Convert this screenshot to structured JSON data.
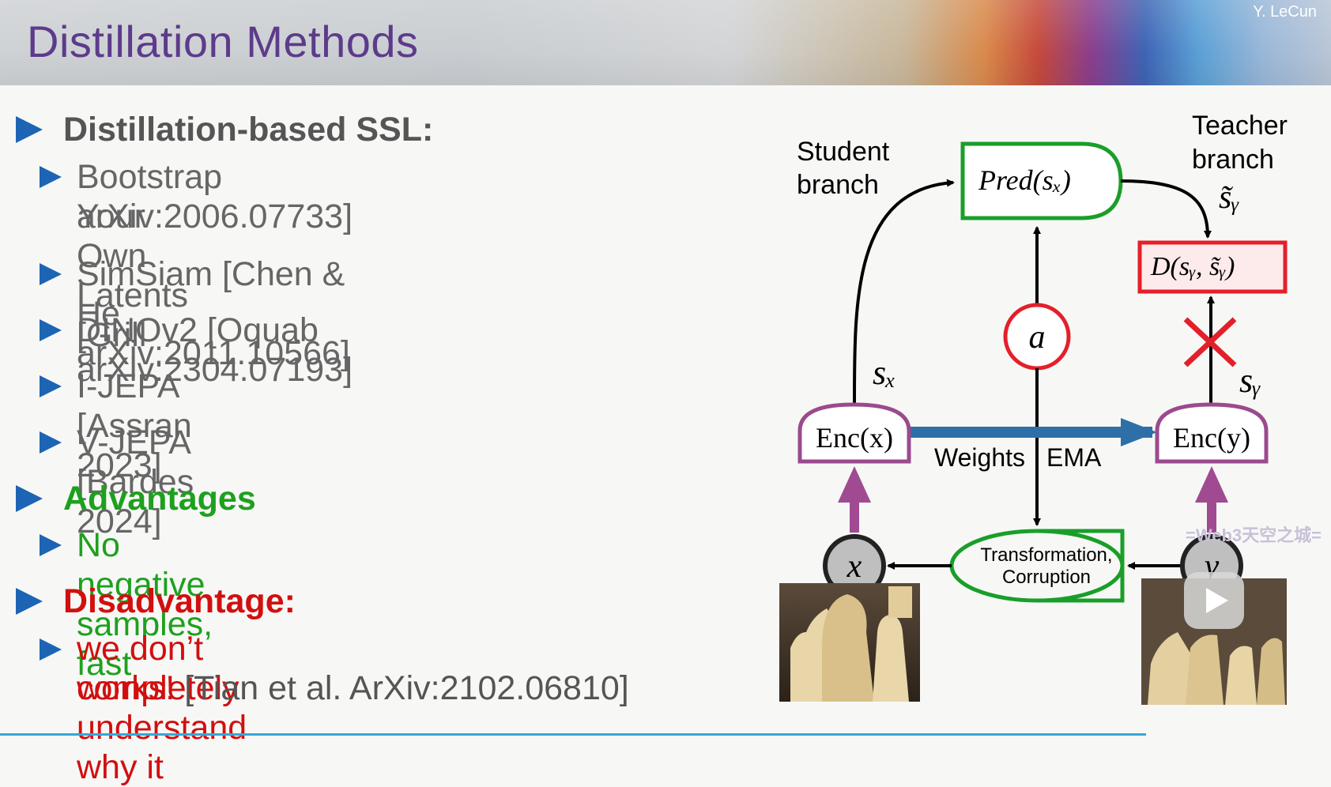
{
  "header": {
    "title": "Distillation Methods",
    "author": "Y. LeCun"
  },
  "bullets": {
    "section1": "Distillation-based SSL:",
    "items": [
      "Bootstrap Your Own Latents [Grill",
      "arXiv:2006.07733]",
      "SimSiam [Chen & He arXiv:2011.10566]",
      "DINOv2 [Oquab arXiv:2304.07193]",
      "I-JEPA [Assran 2023]",
      "V-JEPA [Bardes 2024]"
    ],
    "advantages": "Advantages",
    "advantage_item": "No negative samples, fast",
    "disadvantage": "Disadvantage:",
    "disadvantage_item_line1": "we don’t completely understand why it",
    "disadvantage_item_line2_red": "works!",
    "disadvantage_item_line2_ref": "[Tian et al. ArXiv:2102.06810]"
  },
  "diagram": {
    "student_label_1": "Student",
    "student_label_2": "branch",
    "teacher_label_1": "Teacher",
    "teacher_label_2": "branch",
    "pred": "Pred(sₓ)",
    "dist": "D(sᵧ, s̃ᵧ)",
    "s_tilde_y": "s̃ᵧ",
    "a": "a",
    "s_x": "sₓ",
    "s_y": "sᵧ",
    "enc_x": "Enc(x)",
    "enc_y": "Enc(y)",
    "weights": "Weights",
    "ema": "EMA",
    "transform_1": "Transformation,",
    "transform_2": "Corruption",
    "x": "x",
    "y": "y"
  },
  "colors": {
    "title": "#5d3b8a",
    "bullet_triangle": "#1d64b4",
    "green_text": "#1ea01e",
    "red_text": "#d20f0f",
    "pred_border": "#1a9e2a",
    "dist_border": "#e3202a",
    "enc_border": "#9b4a8e",
    "ema_arrow": "#2f6fa8"
  },
  "watermark": "=Web3天空之城="
}
